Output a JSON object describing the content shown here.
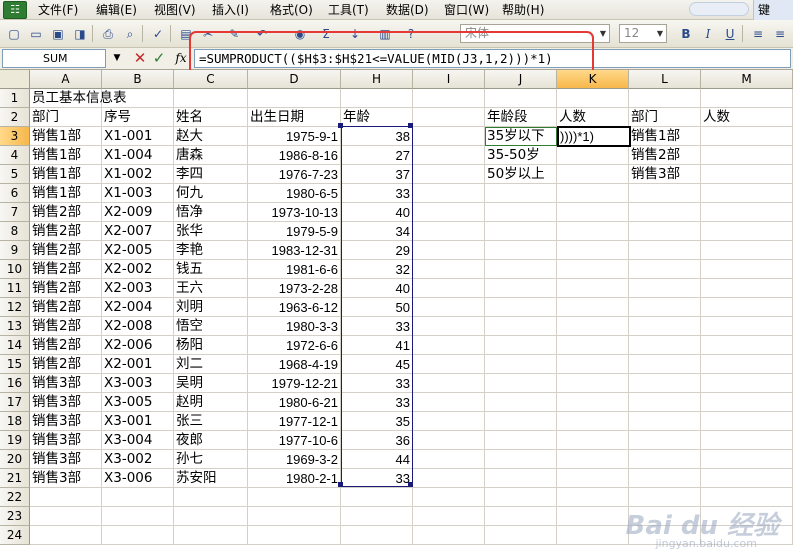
{
  "menu": [
    "文件(F)",
    "编辑(E)",
    "视图(V)",
    "插入(I)",
    "格式(O)",
    "工具(T)",
    "数据(D)",
    "窗口(W)",
    "帮助(H)"
  ],
  "menu_right_label": "键",
  "toolbar": {
    "font_name": "宋体",
    "font_size": "12",
    "bold_label": "B",
    "italic_label": "I",
    "underline_label": "U",
    "sum_label": "Σ"
  },
  "formula_bar": {
    "name_box": "SUM",
    "formula": "=SUMPRODUCT(($H$3:$H$21<=VALUE(MID(J3,1,2)))*1)",
    "fx_label": "fx",
    "cancel_label": "✕",
    "enter_label": "✓"
  },
  "columns": [
    "A",
    "B",
    "C",
    "D",
    "H",
    "I",
    "J",
    "K",
    "L",
    "M"
  ],
  "active_column": "K",
  "active_row": 3,
  "rows": [
    "1",
    "2",
    "3",
    "4",
    "5",
    "6",
    "7",
    "8",
    "9",
    "10",
    "11",
    "12",
    "13",
    "14",
    "15",
    "16",
    "17",
    "18",
    "19",
    "20",
    "21",
    "22",
    "23",
    "24"
  ],
  "sheet": {
    "title": "员工基本信息表",
    "headers": {
      "dept": "部门",
      "id": "序号",
      "name": "姓名",
      "birth": "出生日期",
      "age": "年龄"
    },
    "employees": [
      [
        "销售1部",
        "X1-001",
        "赵大",
        "1975-9-1",
        "38"
      ],
      [
        "销售1部",
        "X1-004",
        "唐森",
        "1986-8-16",
        "27"
      ],
      [
        "销售1部",
        "X1-002",
        "李四",
        "1976-7-23",
        "37"
      ],
      [
        "销售1部",
        "X1-003",
        "何九",
        "1980-6-5",
        "33"
      ],
      [
        "销售2部",
        "X2-009",
        "悟净",
        "1973-10-13",
        "40"
      ],
      [
        "销售2部",
        "X2-007",
        "张华",
        "1979-5-9",
        "34"
      ],
      [
        "销售2部",
        "X2-005",
        "李艳",
        "1983-12-31",
        "29"
      ],
      [
        "销售2部",
        "X2-002",
        "钱五",
        "1981-6-6",
        "32"
      ],
      [
        "销售2部",
        "X2-003",
        "王六",
        "1973-2-28",
        "40"
      ],
      [
        "销售2部",
        "X2-004",
        "刘明",
        "1963-6-12",
        "50"
      ],
      [
        "销售2部",
        "X2-008",
        "悟空",
        "1980-3-3",
        "33"
      ],
      [
        "销售2部",
        "X2-006",
        "杨阳",
        "1972-6-6",
        "41"
      ],
      [
        "销售2部",
        "X2-001",
        "刘二",
        "1968-4-19",
        "45"
      ],
      [
        "销售3部",
        "X3-003",
        "吴明",
        "1979-12-21",
        "33"
      ],
      [
        "销售3部",
        "X3-005",
        "赵明",
        "1980-6-21",
        "33"
      ],
      [
        "销售3部",
        "X3-001",
        "张三",
        "1977-12-1",
        "35"
      ],
      [
        "销售3部",
        "X3-004",
        "夜郎",
        "1977-10-6",
        "36"
      ],
      [
        "销售3部",
        "X3-002",
        "孙七",
        "1969-3-2",
        "44"
      ],
      [
        "销售3部",
        "X3-006",
        "苏安阳",
        "1980-2-1",
        "33"
      ]
    ],
    "age_table": {
      "header_group": "年龄段",
      "header_count": "人数",
      "groups": [
        "35岁以下",
        "35-50岁",
        "50岁以上"
      ],
      "editing_value": "))))*1)"
    },
    "dept_table": {
      "header_dept": "部门",
      "header_count": "人数",
      "depts": [
        "销售1部",
        "销售2部",
        "销售3部"
      ]
    }
  },
  "watermark": "Bai du 经验",
  "watermark_sub": "jingyan.baidu.com"
}
